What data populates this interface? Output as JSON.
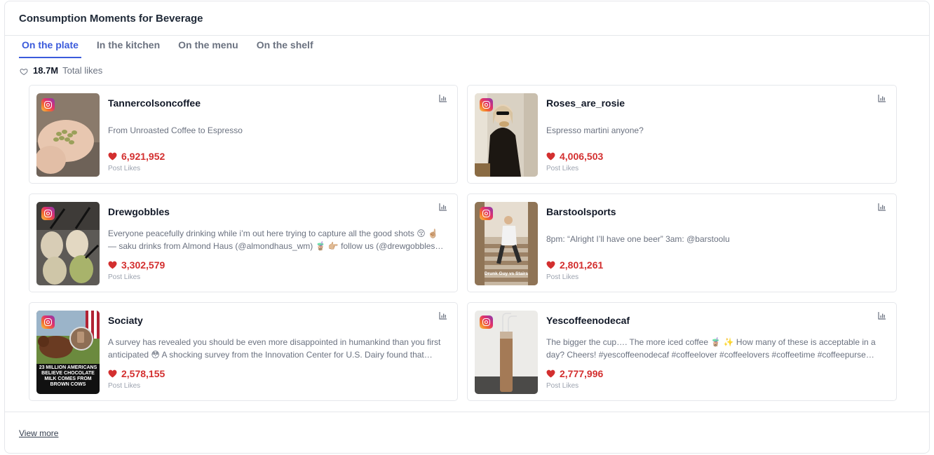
{
  "header": {
    "title": "Consumption Moments for Beverage"
  },
  "tabs": [
    {
      "label": "On the plate",
      "active": true
    },
    {
      "label": "In the kitchen",
      "active": false
    },
    {
      "label": "On the menu",
      "active": false
    },
    {
      "label": "On the shelf",
      "active": false
    }
  ],
  "summary": {
    "total": "18.7M",
    "label": "Total likes",
    "icon": "heart-outline-icon"
  },
  "posts": [
    {
      "author": "Tannercolsoncoffee",
      "description": "From Unroasted Coffee to Espresso",
      "likes": "6,921,952",
      "likes_label": "Post Likes",
      "platform": "instagram"
    },
    {
      "author": "Roses_are_rosie",
      "description": "Espresso martini anyone?",
      "likes": "4,006,503",
      "likes_label": "Post Likes",
      "platform": "instagram"
    },
    {
      "author": "Drewgobbles",
      "description": "Everyone peacefully drinking while i’m out here trying to capture all the good shots 😚 ☝🏼 — saku drinks from Almond Haus (@almondhaus_wm) 🧋 👉🏼 follow us (@drewgobbles) f…",
      "likes": "3,302,579",
      "likes_label": "Post Likes",
      "platform": "instagram"
    },
    {
      "author": "Barstoolsports",
      "description": "8pm: “Alright I’ll have one beer” 3am: @barstoolu",
      "likes": "2,801,261",
      "likes_label": "Post Likes",
      "platform": "instagram",
      "thumb_caption": "Drunk Guy vs Stairs"
    },
    {
      "author": "Sociaty",
      "description": "A survey has revealed you should be even more disappointed in humankind than you first anticipated 😳 A shocking survey from the Innovation Center for U.S. Dairy found that…",
      "likes": "2,578,155",
      "likes_label": "Post Likes",
      "platform": "instagram",
      "thumb_caption": "23 MILLION AMERICANS BELIEVE CHOCOLATE MILK COMES FROM BROWN COWS"
    },
    {
      "author": "Yescoffeenodecaf",
      "description": "The bigger the cup…. The more iced coffee 🧋 ✨ How many of these is acceptable in a day? Cheers! #yescoffeenodecaf #coffeelover #coffeelovers #coffeetime #coffeepurse…",
      "likes": "2,777,996",
      "likes_label": "Post Likes",
      "platform": "instagram"
    }
  ],
  "footer": {
    "view_more": "View more"
  },
  "colors": {
    "accent": "#3b5bdb",
    "likes": "#d32f2f",
    "border": "#e5e7eb"
  }
}
